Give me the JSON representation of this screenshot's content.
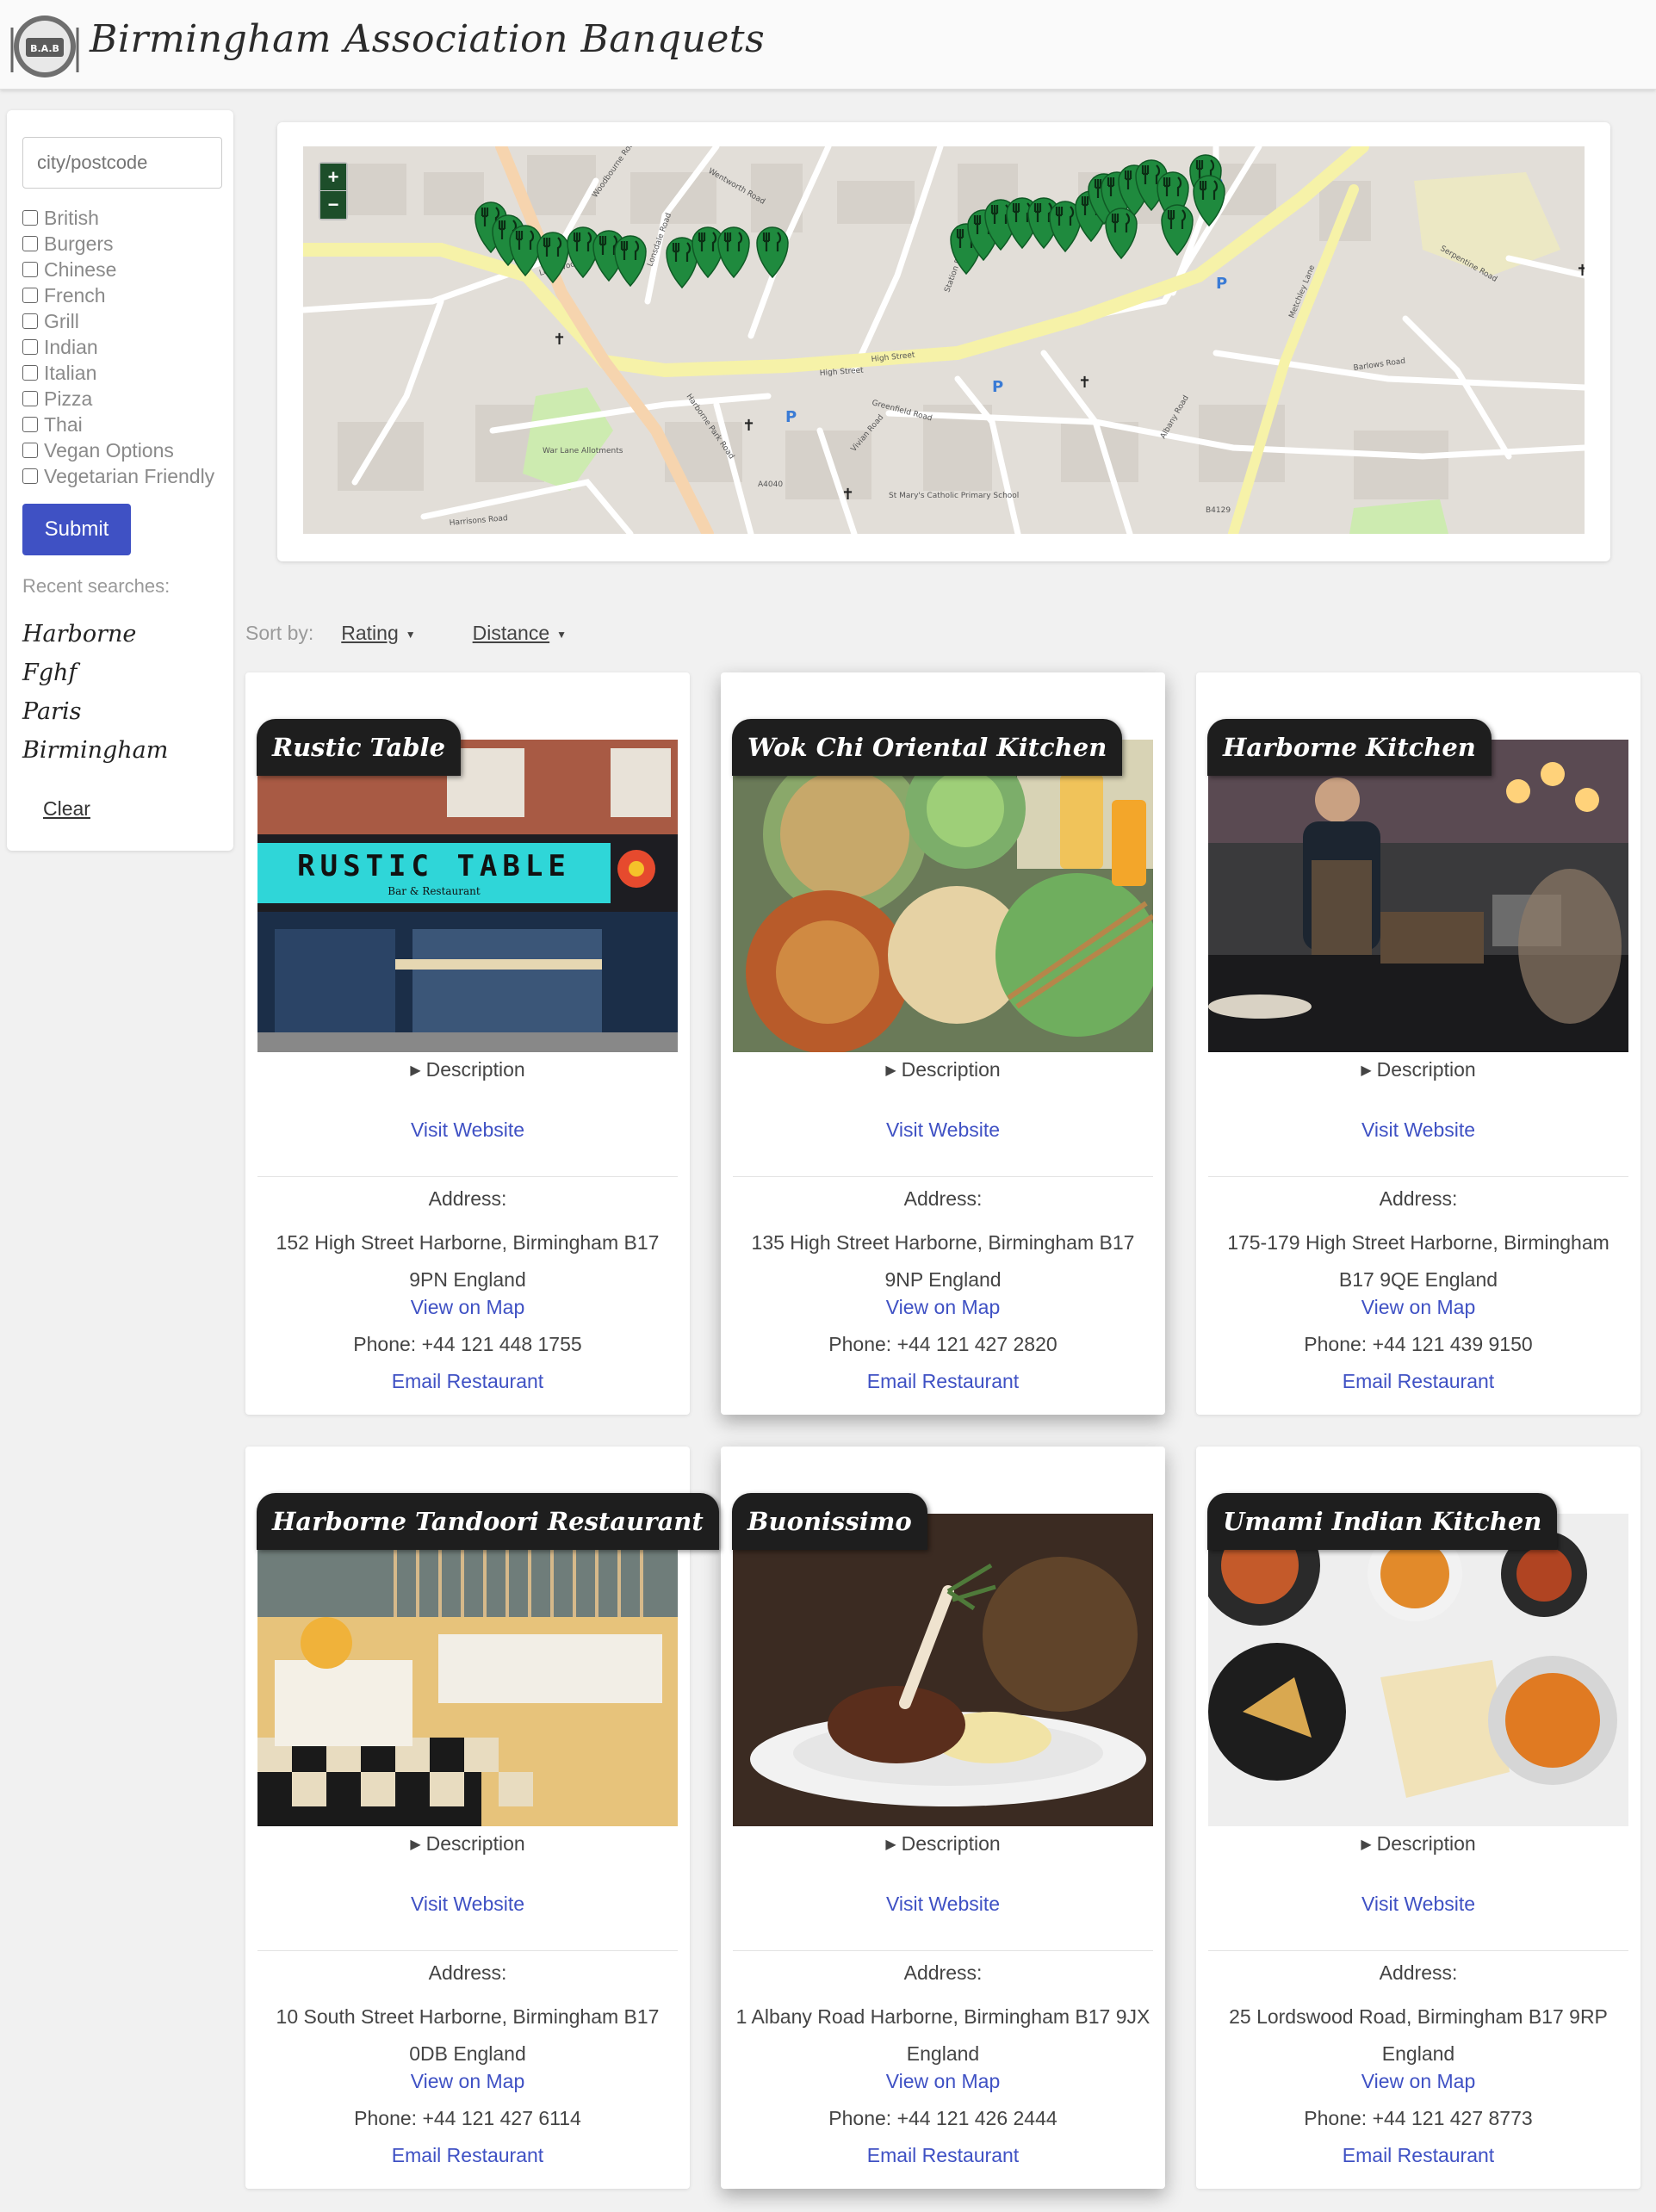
{
  "header": {
    "logo_text": "B.A.B",
    "title": "Birmingham Association Banquets"
  },
  "search": {
    "placeholder": "city/postcode",
    "value": ""
  },
  "filters": [
    "British",
    "Burgers",
    "Chinese",
    "French",
    "Grill",
    "Indian",
    "Italian",
    "Pizza",
    "Thai",
    "Vegan Options",
    "Vegetarian Friendly"
  ],
  "submit_label": "Submit",
  "recent": {
    "label": "Recent searches:",
    "items": [
      "Harborne",
      "Fghf",
      "Paris",
      "Birmingham"
    ],
    "clear_label": "Clear"
  },
  "map": {
    "zoom_in": "+",
    "zoom_out": "−",
    "labels": [
      "High Street",
      "High Street",
      "Lordswood Road",
      "Harborne Park Road",
      "Greenfield Road",
      "Vivian Road",
      "Albany Road",
      "Station Road",
      "Metchley Lane",
      "Barlows Road",
      "Wentworth Road",
      "Serpentine Road",
      "Harrisons Road",
      "Woodbourne Road",
      "Lonsdale Road",
      "A4040",
      "B4129",
      "War Lane Allotments",
      "St Mary's Catholic Primary School"
    ]
  },
  "sort": {
    "label": "Sort by:",
    "options": [
      "Rating",
      "Distance"
    ]
  },
  "card_common": {
    "description": "Description",
    "visit": "Visit Website",
    "address_label": "Address:",
    "view_map": "View on Map",
    "email": "Email Restaurant"
  },
  "restaurants": [
    {
      "name": "Rustic Table",
      "address": "152 High Street Harborne, Birmingham B17 9PN England",
      "phone": "Phone: +44 121 448 1755",
      "sign": "RUSTIC TABLE",
      "sign_sub": "Bar & Restaurant"
    },
    {
      "name": "Wok Chi Oriental Kitchen",
      "address": "135 High Street Harborne, Birmingham B17 9NP England",
      "phone": "Phone: +44 121 427 2820"
    },
    {
      "name": "Harborne Kitchen",
      "address": "175-179 High Street Harborne, Birmingham B17 9QE England",
      "phone": "Phone: +44 121 439 9150"
    },
    {
      "name": "Harborne Tandoori Restaurant",
      "address": "10 South Street Harborne, Birmingham B17 0DB England",
      "phone": "Phone: +44 121 427 6114"
    },
    {
      "name": "Buonissimo",
      "address": "1 Albany Road Harborne, Birmingham B17 9JX England",
      "phone": "Phone: +44 121 426 2444"
    },
    {
      "name": "Umami Indian Kitchen",
      "address": "25 Lordswood Road, Birmingham B17 9RP England",
      "phone": "Phone: +44 121 427 8773"
    }
  ],
  "colors": {
    "accent": "#3f51c4",
    "marker": "#1f8a3e",
    "title_bg": "#1e1e1e"
  }
}
